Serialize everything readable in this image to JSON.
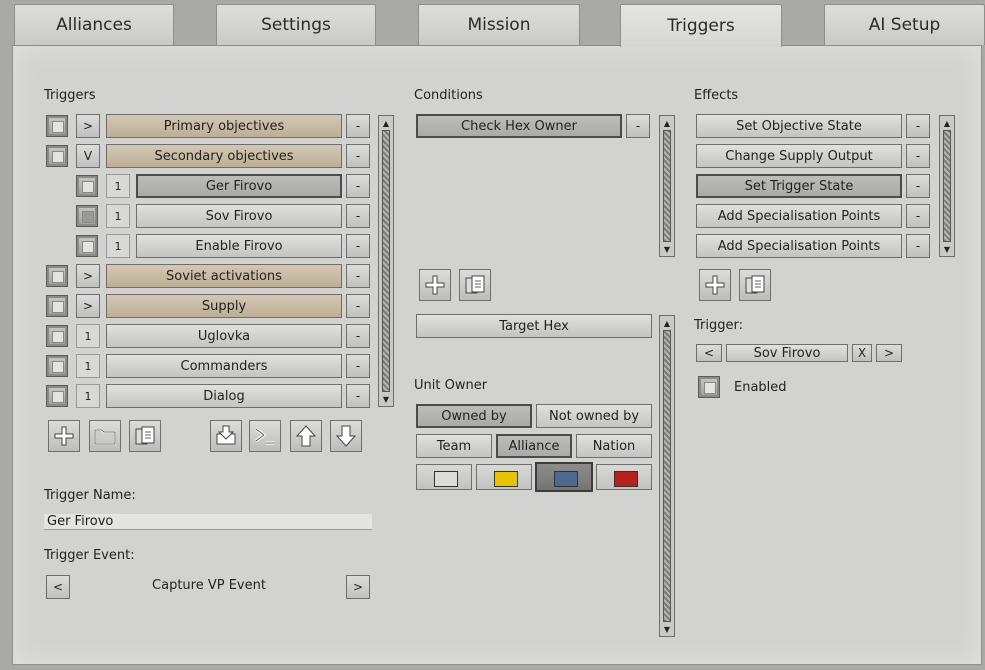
{
  "tabs": [
    {
      "label": "Alliances"
    },
    {
      "label": "Settings"
    },
    {
      "label": "Mission"
    },
    {
      "label": "Triggers"
    },
    {
      "label": "AI Setup"
    }
  ],
  "triggers": {
    "header": "Triggers",
    "items": [
      {
        "expander": ">",
        "label": "Primary objectives"
      },
      {
        "expander": "V",
        "label": "Secondary objectives"
      },
      {
        "expander": "1",
        "label": "Ger Firovo"
      },
      {
        "expander": "1",
        "label": "Sov Firovo"
      },
      {
        "expander": "1",
        "label": "Enable Firovo"
      },
      {
        "expander": ">",
        "label": "Soviet activations"
      },
      {
        "expander": ">",
        "label": "Supply"
      },
      {
        "expander": "1",
        "label": "Uglovka"
      },
      {
        "expander": "1",
        "label": "Commanders"
      },
      {
        "expander": "1",
        "label": "Dialog"
      }
    ],
    "remove_label": "-"
  },
  "trigger_name": {
    "label": "Trigger Name:",
    "value": "Ger Firovo"
  },
  "trigger_event": {
    "label": "Trigger Event:",
    "value": "Capture VP Event",
    "prev": "<",
    "next": ">"
  },
  "conditions": {
    "header": "Conditions",
    "items": [
      {
        "label": "Check Hex Owner"
      }
    ],
    "remove_label": "-",
    "target": "Target Hex",
    "unit_owner_label": "Unit Owner",
    "owned_by": "Owned by",
    "not_owned_by": "Not owned by",
    "team": "Team",
    "alliance": "Alliance",
    "nation": "Nation",
    "colors": [
      "#dcdcdc",
      "#e8c400",
      "#4a6a90",
      "#b8201a"
    ]
  },
  "effects": {
    "header": "Effects",
    "items": [
      {
        "label": "Set Objective State"
      },
      {
        "label": "Change Supply Output"
      },
      {
        "label": "Set Trigger State"
      },
      {
        "label": "Add Specialisation Points"
      },
      {
        "label": "Add Specialisation Points"
      }
    ],
    "remove_label": "-",
    "trigger_label": "Trigger:",
    "trigger_value": "Sov Firovo",
    "prev": "<",
    "clear": "X",
    "next": ">",
    "enabled_label": "Enabled"
  }
}
